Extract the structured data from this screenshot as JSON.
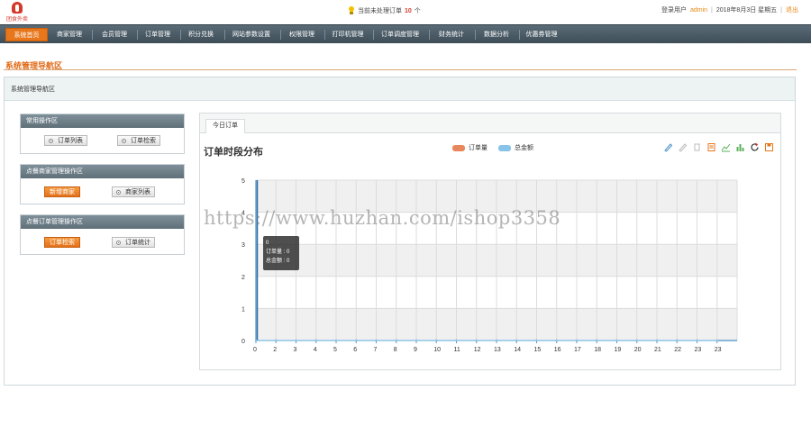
{
  "logo": {
    "text": "团食外卖"
  },
  "notice": {
    "prefix": "当前未处理订单",
    "count": "10",
    "suffix": "个"
  },
  "user": {
    "label": "登录用户",
    "name": "admin",
    "date": "2018年8月3日 星期五",
    "logout": "退出"
  },
  "nav": {
    "items": [
      "系统首页",
      "商家管理",
      "会员管理",
      "订单管理",
      "积分兑换",
      "网站参数设置",
      "权限管理",
      "打印机管理",
      "订单调度管理",
      "财务统计",
      "数据分析",
      "优惠券管理"
    ],
    "active_index": 0
  },
  "page": {
    "section_title": "系统管理导航区",
    "panel_title": "系统管理导航区"
  },
  "quick_panels": [
    {
      "title": "常用操作区",
      "buttons": [
        "订单列表",
        "订单检索"
      ]
    },
    {
      "title": "点餐商家管理操作区",
      "buttons": [
        "新增商家",
        "商家列表"
      ]
    },
    {
      "title": "点餐订单管理操作区",
      "buttons": [
        "订单检索",
        "订单统计"
      ]
    }
  ],
  "chart_panel": {
    "tab": "今日订单",
    "title": "订单时段分布"
  },
  "tooltip": {
    "hour": "0",
    "line1": "订单量 : 0",
    "line2": "总金额 : 0"
  },
  "watermark": "https://www.huzhan.com/ishop3358",
  "toolbox_icons": [
    "mark-icon",
    "erase-icon",
    "data-view-icon",
    "line-chart-icon",
    "bar-chart-icon",
    "refresh-icon",
    "save-image-icon"
  ],
  "colors": {
    "accent": "#e8771c",
    "nav_bg": "#4c5c66",
    "series_orders": "#e8875b",
    "series_amount": "#87c4e8"
  },
  "chart_data": {
    "type": "line",
    "title": "订单时段分布",
    "x": [
      "0",
      "1",
      "2",
      "3",
      "4",
      "5",
      "6",
      "7",
      "8",
      "9",
      "10",
      "11",
      "12",
      "13",
      "14",
      "15",
      "16",
      "17",
      "18",
      "19",
      "20",
      "21",
      "22",
      "23"
    ],
    "x_tick_labels": [
      "0",
      "2",
      "3",
      "4",
      "5",
      "6",
      "7",
      "8",
      "9",
      "10",
      "11",
      "12",
      "13",
      "14",
      "15",
      "16",
      "17",
      "18",
      "19",
      "20",
      "21",
      "22",
      "23",
      "23"
    ],
    "series": [
      {
        "name": "订单量",
        "values": [
          0,
          0,
          0,
          0,
          0,
          0,
          0,
          0,
          0,
          0,
          0,
          0,
          0,
          0,
          0,
          0,
          0,
          0,
          0,
          0,
          0,
          0,
          0,
          0
        ]
      },
      {
        "name": "总金额",
        "values": [
          0,
          0,
          0,
          0,
          0,
          0,
          0,
          0,
          0,
          0,
          0,
          0,
          0,
          0,
          0,
          0,
          0,
          0,
          0,
          0,
          0,
          0,
          0,
          0
        ]
      }
    ],
    "yticks": [
      "0",
      "1",
      "2",
      "3",
      "4",
      "5"
    ],
    "ylim": [
      0,
      5
    ],
    "grid": true,
    "legend_position": "top-center"
  }
}
